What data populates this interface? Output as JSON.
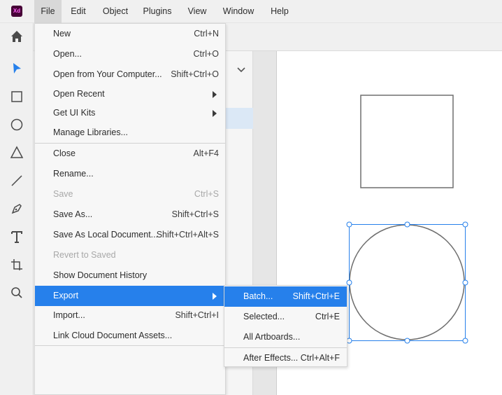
{
  "app": {
    "logo_text": "Xd",
    "logo_color": "#470137",
    "logo_text_color": "#ff61f6"
  },
  "menubar": {
    "items": [
      {
        "label": "File",
        "active": true
      },
      {
        "label": "Edit"
      },
      {
        "label": "Object"
      },
      {
        "label": "Plugins"
      },
      {
        "label": "View"
      },
      {
        "label": "Window"
      },
      {
        "label": "Help"
      }
    ]
  },
  "toolbar": {
    "tools": [
      "home-icon",
      "select-arrow-icon",
      "rectangle-icon",
      "ellipse-icon",
      "polygon-icon",
      "line-icon",
      "pen-icon",
      "text-icon",
      "artboard-icon",
      "zoom-icon"
    ],
    "accent": "#2680eb"
  },
  "file_menu": {
    "items": [
      {
        "label": "New",
        "shortcut": "Ctrl+N"
      },
      {
        "label": "Open...",
        "shortcut": "Ctrl+O"
      },
      {
        "label": "Open from Your Computer...",
        "shortcut": "Shift+Ctrl+O"
      },
      {
        "label": "Open Recent",
        "shortcut": ""
      },
      {
        "label": "Get UI Kits",
        "shortcut": ""
      },
      {
        "label": "Manage Libraries...",
        "shortcut": ""
      },
      {
        "label": "Close",
        "shortcut": "Alt+F4"
      },
      {
        "label": "Rename...",
        "shortcut": ""
      },
      {
        "label": "Save",
        "shortcut": "Ctrl+S",
        "disabled": true
      },
      {
        "label": "Save As...",
        "shortcut": "Shift+Ctrl+S"
      },
      {
        "label": "Save As Local Document...",
        "shortcut": "Shift+Ctrl+Alt+S"
      },
      {
        "label": "Revert to Saved",
        "shortcut": "",
        "disabled": true
      },
      {
        "label": "Show Document History",
        "shortcut": ""
      },
      {
        "label": "Export",
        "shortcut": "",
        "active": true
      },
      {
        "label": "Import...",
        "shortcut": "Shift+Ctrl+I"
      },
      {
        "label": "Link Cloud Document Assets...",
        "shortcut": ""
      }
    ]
  },
  "export_submenu": {
    "items": [
      {
        "label": "Batch...",
        "shortcut": "Shift+Ctrl+E",
        "active": true
      },
      {
        "label": "Selected...",
        "shortcut": "Ctrl+E"
      },
      {
        "label": "All Artboards...",
        "shortcut": ""
      },
      {
        "label": "After Effects...",
        "shortcut": "Ctrl+Alt+F"
      }
    ]
  },
  "colors": {
    "menu_highlight": "#2680eb",
    "selection": "#2680eb",
    "shape_stroke": "#6e6e6e"
  }
}
